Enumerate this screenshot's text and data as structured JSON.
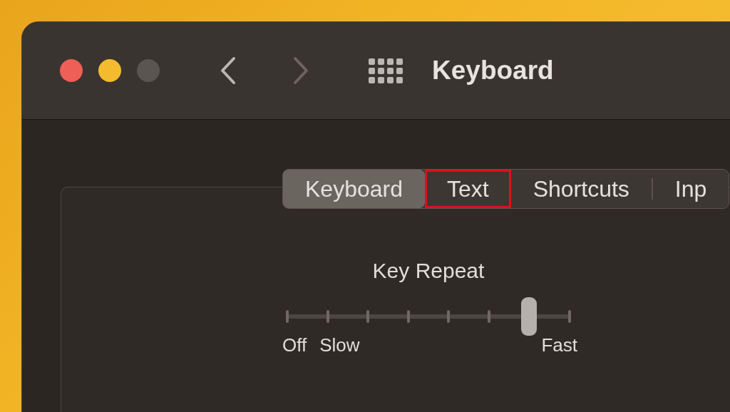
{
  "window": {
    "title": "Keyboard"
  },
  "tabs": [
    {
      "label": "Keyboard",
      "selected": true,
      "highlighted": false
    },
    {
      "label": "Text",
      "selected": false,
      "highlighted": true
    },
    {
      "label": "Shortcuts",
      "selected": false,
      "highlighted": false
    },
    {
      "label": "Inp",
      "selected": false,
      "highlighted": false
    }
  ],
  "key_repeat": {
    "title": "Key Repeat",
    "level": 0.857,
    "labels": [
      "Off",
      "Slow",
      "Fast"
    ]
  }
}
